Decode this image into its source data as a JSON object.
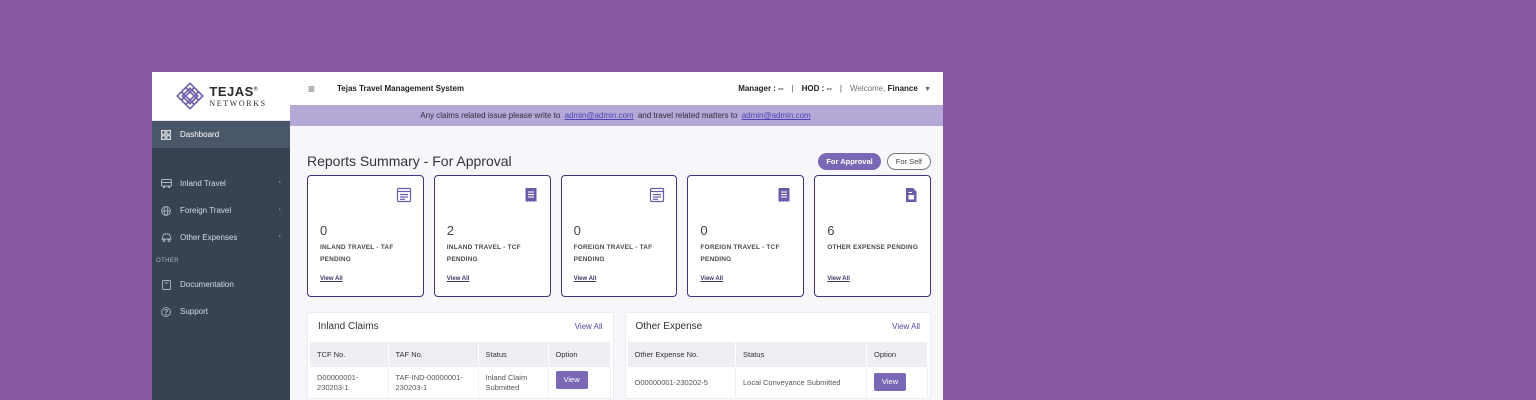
{
  "brand": {
    "name": "TEJAS",
    "sub": "NETWORKS",
    "reg": "®"
  },
  "sidebar": {
    "items": [
      {
        "label": "Dashboard",
        "icon": "dashboard-icon"
      },
      {
        "label": "Inland Travel",
        "icon": "bus-icon"
      },
      {
        "label": "Foreign Travel",
        "icon": "globe-icon"
      },
      {
        "label": "Other Expenses",
        "icon": "car-icon"
      }
    ],
    "section_other": "OTHER",
    "other_items": [
      {
        "label": "Documentation",
        "icon": "book-icon"
      },
      {
        "label": "Support",
        "icon": "help-circle-icon"
      }
    ]
  },
  "topbar": {
    "menu_icon": "hamburger-icon",
    "title": "Tejas Travel Management System",
    "manager_label": "Manager :",
    "manager_value": "--",
    "sep": "|",
    "hod_label": "HOD :",
    "hod_value": "--",
    "welcome_prefix": "Welcome,",
    "welcome_user": "Finance"
  },
  "notice": {
    "part1": "Any claims related issue please write to",
    "email1": "admin@admin.com",
    "part2": "and travel related matters to",
    "email2": "admin@admin.com"
  },
  "summary": {
    "title": "Reports Summary - For Approval",
    "pill_active": "For Approval",
    "pill_inactive": "For Self",
    "cards": [
      {
        "count": "0",
        "label": "INLAND TRAVEL - TAF PENDING",
        "link": "View All",
        "icon": "form-icon"
      },
      {
        "count": "2",
        "label": "INLAND TRAVEL - TCF PENDING",
        "link": "View All",
        "icon": "receipt-icon"
      },
      {
        "count": "0",
        "label": "FOREIGN TRAVEL - TAF PENDING",
        "link": "View All",
        "icon": "form-icon"
      },
      {
        "count": "0",
        "label": "FOREIGN TRAVEL - TCF PENDING",
        "link": "View All",
        "icon": "receipt-icon"
      },
      {
        "count": "6",
        "label": "OTHER EXPENSE PENDING",
        "link": "View All",
        "icon": "document-icon"
      }
    ]
  },
  "inland_claims": {
    "title": "Inland Claims",
    "view_all": "View All",
    "columns": [
      "TCF No.",
      "TAF No.",
      "Status",
      "Option"
    ],
    "rows": [
      {
        "tcf": "D00000001-230203-1",
        "taf": "TAF-IND-00000001-230203-1",
        "status": "Inland Claim Submitted",
        "option": "View"
      }
    ]
  },
  "other_expense": {
    "title": "Other Expense",
    "view_all": "View All",
    "columns": [
      "Other Expense No.",
      "Status",
      "Option"
    ],
    "rows": [
      {
        "no": "O00000001-230202-5",
        "status": "Local Conveyance Submitted",
        "option": "View"
      }
    ]
  },
  "colors": {
    "background": "#8659a2",
    "sidebar": "#374352",
    "accent": "#7a67b5",
    "card_border": "#3d3581",
    "notice": "#b4a8d6"
  }
}
